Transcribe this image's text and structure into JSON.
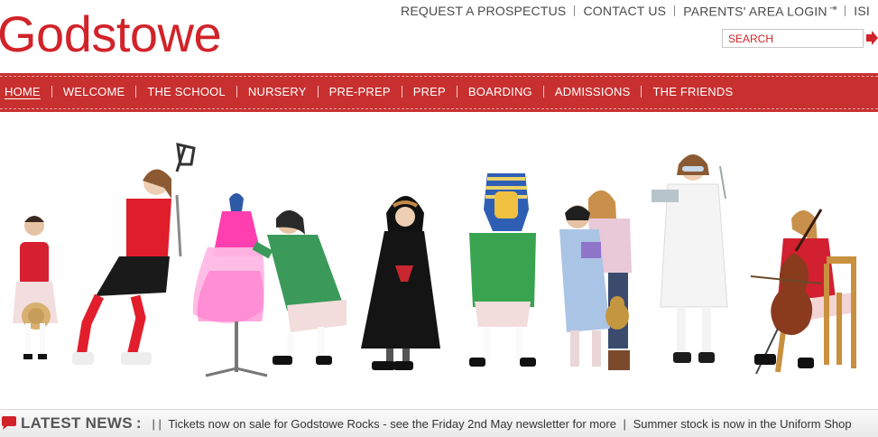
{
  "site": {
    "logo_text": "Godstowe",
    "brand_color": "#d2232a"
  },
  "utility_links": [
    {
      "label": "REQUEST A PROSPECTUS"
    },
    {
      "label": "CONTACT US"
    },
    {
      "label": "PARENTS' AREA LOGIN"
    },
    {
      "label": "ISI"
    }
  ],
  "search": {
    "placeholder": "SEARCH"
  },
  "nav": {
    "items": [
      {
        "label": "HOME",
        "active": true
      },
      {
        "label": "WELCOME"
      },
      {
        "label": "THE SCHOOL"
      },
      {
        "label": "NURSERY"
      },
      {
        "label": "PRE-PREP"
      },
      {
        "label": "PREP"
      },
      {
        "label": "BOARDING"
      },
      {
        "label": "ADMISSIONS"
      },
      {
        "label": "THE FRIENDS"
      }
    ],
    "bar_color": "#c8302f"
  },
  "hero": {
    "figures": [
      {
        "name": "girl-red-cardigan-hat",
        "colors": [
          "#d62030",
          "#f2dede"
        ]
      },
      {
        "name": "lacrosse-player",
        "colors": [
          "#e01d2a",
          "#1a1a1a"
        ]
      },
      {
        "name": "dress-mannequin",
        "colors": [
          "#ff4fb3",
          "#ffd1ee"
        ]
      },
      {
        "name": "girl-green-smock",
        "colors": [
          "#3b9a5a",
          "#f2dcdc"
        ]
      },
      {
        "name": "girl-black-cloak",
        "colors": [
          "#111111",
          "#c9272f"
        ]
      },
      {
        "name": "pharaoh-mask-student",
        "colors": [
          "#38a44f",
          "#f2dcdc"
        ]
      },
      {
        "name": "children-reading-pyjamas",
        "colors": [
          "#aac4e6",
          "#e9c9d7"
        ]
      },
      {
        "name": "scientist-lab-coat",
        "colors": [
          "#f4f4f4",
          "#1d1d1d"
        ]
      },
      {
        "name": "cellist-chair",
        "colors": [
          "#d22030",
          "#8a3b1e"
        ]
      }
    ]
  },
  "news": {
    "label": "LATEST NEWS",
    "colon": ":",
    "ticker_prefix": "| |",
    "items": [
      "Tickets now on sale for Godstowe Rocks - see the Friday 2nd May newsletter for more",
      "Summer stock is now in the Uniform Shop"
    ],
    "separator": "|"
  }
}
